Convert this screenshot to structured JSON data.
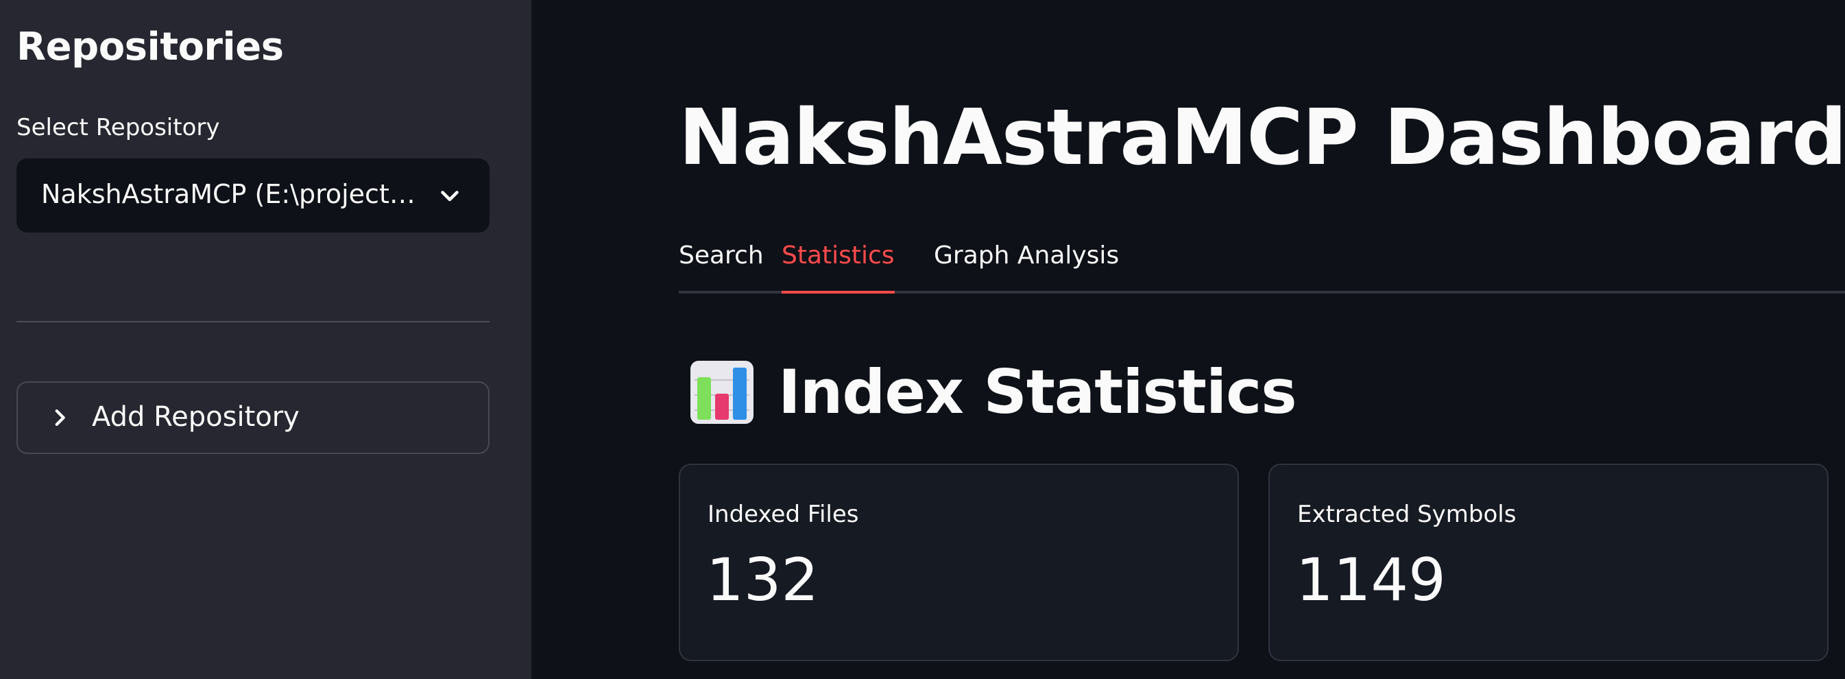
{
  "sidebar": {
    "title": "Repositories",
    "select_label": "Select Repository",
    "selected_repository": "NakshAstraMCP (E:\\project…",
    "add_repository_label": "Add Repository"
  },
  "main": {
    "title": "NakshAstraMCP Dashboard",
    "tabs": [
      {
        "label": "Search",
        "active": false
      },
      {
        "label": "Statistics",
        "active": true
      },
      {
        "label": "Graph Analysis",
        "active": false
      }
    ],
    "section_title": "Index Statistics",
    "section_icon": "bar-chart-icon",
    "metrics": [
      {
        "label": "Indexed Files",
        "value": "132"
      },
      {
        "label": "Extracted Symbols",
        "value": "1149"
      }
    ]
  },
  "colors": {
    "sidebar_bg": "#262730",
    "main_bg": "#0e1117",
    "accent": "#ff4b4b",
    "text": "#fafafa"
  }
}
